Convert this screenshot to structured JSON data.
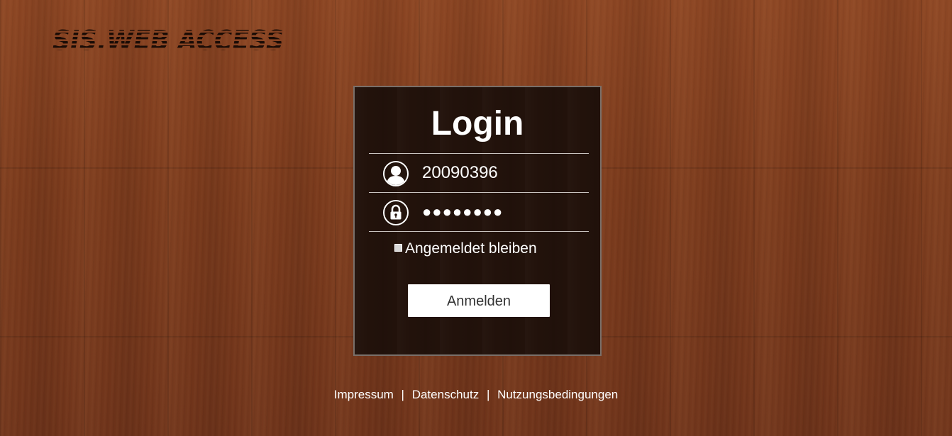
{
  "logo": {
    "text": "SIS.WEB ACCESS",
    "color": "#1a0c06"
  },
  "login": {
    "title": "Login",
    "username_value": "20090396",
    "username_icon": "user-icon",
    "password_masked": "●●●●●●●●",
    "password_icon": "lock-icon",
    "remember_label": "Angemeldet bleiben",
    "remember_checked": false,
    "submit_label": "Anmelden"
  },
  "footer": {
    "links": [
      "Impressum",
      "Datenschutz",
      "Nutzungsbedingungen"
    ],
    "separator": "|"
  },
  "colors": {
    "panel_background": "#22120b",
    "panel_border": "#7a706a",
    "wood": "#7a3a1c",
    "text": "#ffffff",
    "button_background": "#ffffff",
    "button_text": "#333333"
  }
}
